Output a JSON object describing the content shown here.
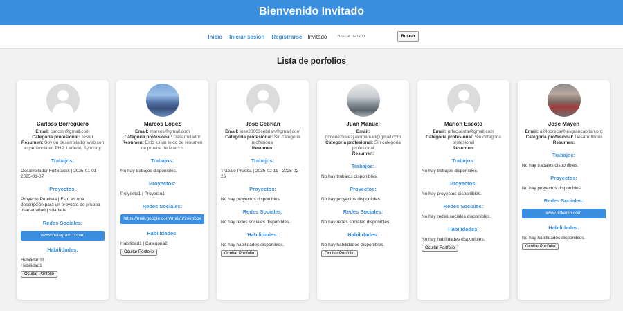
{
  "header": {
    "title": "Bienvenido Invitado"
  },
  "nav": {
    "inicio": "Inicio",
    "iniciar_sesion": "Iniciar sesion",
    "registrarse": "Registrarse",
    "guest": "Invitado",
    "search_placeholder": "Buscar usuario",
    "search_button": "Buscar"
  },
  "main": {
    "title": "Lista de porfolios"
  },
  "labels": {
    "email": "Email:",
    "categoria": "Categoría profesional:",
    "resumen": "Resumen:",
    "trabajos": "Trabajos:",
    "proyectos": "Proyectos:",
    "redes": "Redes Sociales:",
    "habilidades": "Habilidades:",
    "ocultar": "Ocultar Portfolio"
  },
  "cards": [
    {
      "avatar": "default-user-icon",
      "name": "Carloss Borreguero",
      "email": "carloss@gmail.com",
      "categoria": "Tester",
      "resumen": "Soy un desarrollador web con experiencia en PHP, Laravel, Symfony",
      "trabajos": "Desarrollador FullStackk | 2025-01-01 - 2025-01-07",
      "proyectos": "Proyecto Pruebaa | Esto es una descripción para un proyecto de prueba dsadadadad | sdadada",
      "redes": "www.instagram.comm",
      "habilidades_1": "Habilidad11 |",
      "habilidades_2": "Habilidad1 |"
    },
    {
      "avatar": "profile-photo",
      "name": "Marcos López",
      "email": "marcos@gmail.com",
      "categoria": "Desarrollador",
      "resumen": "Esto es un texto de resumen de prueba de Marcos",
      "trabajos": "No hay trabajos disponibles.",
      "proyectos": "Proyecto1 | Proyecto1",
      "redes": "https://mail.google.com/mail/u/2/#inbox",
      "habilidades_1": "Habilidad1 | Categoria2",
      "habilidades_2": ""
    },
    {
      "avatar": "default-user-icon",
      "name": "Jose Cebrián",
      "email": "jose20003cebrian@gmail.com",
      "categoria": "Sin categoria profesional",
      "resumen": "",
      "trabajos": "Trabajo Prueba | 2025-02-11 - 2025-02-26",
      "proyectos": "No hay proyectos disponibles.",
      "redes": "No hay redes sociales disponibles.",
      "habilidades_1": "No hay habilidades disponibles.",
      "habilidades_2": ""
    },
    {
      "avatar": "profile-photo",
      "name": "Juan Manuel",
      "email": "gimenezvelezjuanmanuel@gmail.com",
      "categoria": "Sin categoria profesional",
      "resumen": "",
      "trabajos": "No hay trabajos disponibles.",
      "proyectos": "No hay proyectos disponibles.",
      "redes": "No hay redes sociales disponibles.",
      "habilidades_1": "No hay habilidades disponibles.",
      "habilidades_2": ""
    },
    {
      "avatar": "default-user-icon",
      "name": "Marlon Escoto",
      "email": "prfacuenta@gmail.com",
      "categoria": "Sin categoria profesional",
      "resumen": "",
      "trabajos": "No hay trabajos disponibles.",
      "proyectos": "No hay proyectos disponibles.",
      "redes": "No hay redes sociales disponibles.",
      "habilidades_1": "No hay habilidades disponibles.",
      "habilidades_2": ""
    },
    {
      "avatar": "profile-photo",
      "name": "Jose Mayen",
      "email": "a24boreca@iesgrancapitan.org",
      "categoria": "Desarrollador",
      "resumen": "",
      "trabajos": "No hay trabajos disponibles.",
      "proyectos": "No hay proyectos disponibles.",
      "redes": "www.linkedin.com",
      "habilidades_1": "No hay habilidades disponibles.",
      "habilidades_2": ""
    }
  ]
}
